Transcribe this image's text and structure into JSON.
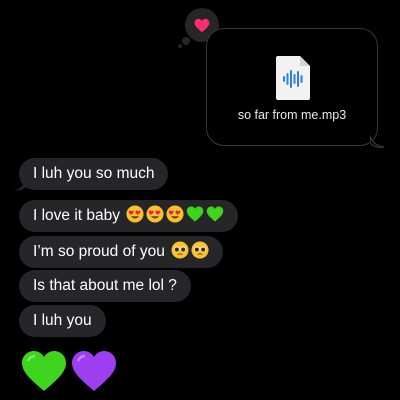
{
  "reaction": {
    "icon": "heart-reaction-icon",
    "color": "#ff2d6f"
  },
  "attachment": {
    "icon": "audio-file-icon",
    "filename": "so far from me.mp3",
    "accent": "#2f7fe0"
  },
  "messages": [
    {
      "text": "I luh you so much",
      "emojis": []
    },
    {
      "text": "I love it baby",
      "emojis": [
        "heart-eyes-emoji",
        "heart-eyes-emoji",
        "heart-eyes-emoji",
        "green-heart-emoji",
        "green-heart-emoji"
      ]
    },
    {
      "text": "I’m so proud of you",
      "emojis": [
        "pleading-face-emoji",
        "pleading-face-emoji"
      ]
    },
    {
      "text": "Is that about me lol ?",
      "emojis": []
    },
    {
      "text": "I luh you",
      "emojis": []
    }
  ],
  "big_emojis": [
    "green-heart-emoji",
    "purple-heart-emoji"
  ],
  "colors": {
    "bubble": "#262628",
    "green_heart": "#3fd51f",
    "purple_heart": "#9b3ff0"
  }
}
